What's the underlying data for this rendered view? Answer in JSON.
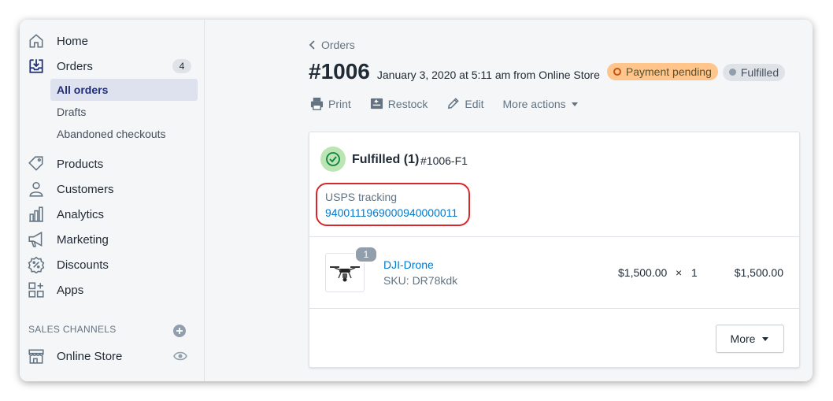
{
  "sidebar": {
    "items": [
      {
        "label": "Home",
        "icon": "home-icon"
      },
      {
        "label": "Orders",
        "icon": "orders-icon",
        "badge": "4"
      },
      {
        "label": "Products",
        "icon": "tag-icon"
      },
      {
        "label": "Customers",
        "icon": "person-icon"
      },
      {
        "label": "Analytics",
        "icon": "bar-chart-icon"
      },
      {
        "label": "Marketing",
        "icon": "megaphone-icon"
      },
      {
        "label": "Discounts",
        "icon": "discount-icon"
      },
      {
        "label": "Apps",
        "icon": "apps-icon"
      }
    ],
    "order_subitems": [
      "All orders",
      "Drafts",
      "Abandoned checkouts"
    ],
    "section_title": "SALES CHANNELS",
    "channel": {
      "label": "Online Store",
      "icon": "store-icon"
    }
  },
  "breadcrumb": {
    "label": "Orders"
  },
  "header": {
    "order_number": "#1006",
    "meta": "January 3, 2020 at 5:11 am from Online Store",
    "payment_status": "Payment pending",
    "fulfillment_status": "Fulfilled"
  },
  "actions": {
    "print": "Print",
    "restock": "Restock",
    "edit": "Edit",
    "more": "More actions"
  },
  "card": {
    "title": "Fulfilled (1)",
    "fulfillment_id": "#1006-F1",
    "tracking_label": "USPS tracking",
    "tracking_number": "9400111969000940000011",
    "line_item": {
      "quantity_badge": "1",
      "name": "DJI-Drone",
      "sku": "SKU: DR78kdk",
      "price": "$1,500.00",
      "times": "×",
      "quantity": "1",
      "total": "$1,500.00"
    },
    "more_button": "More"
  },
  "colors": {
    "accent": "#202e78",
    "link": "#007ace",
    "pending_pill": "#ffc58b",
    "fulfilled_check": "#bbe5b3",
    "highlight": "#d9262b"
  }
}
